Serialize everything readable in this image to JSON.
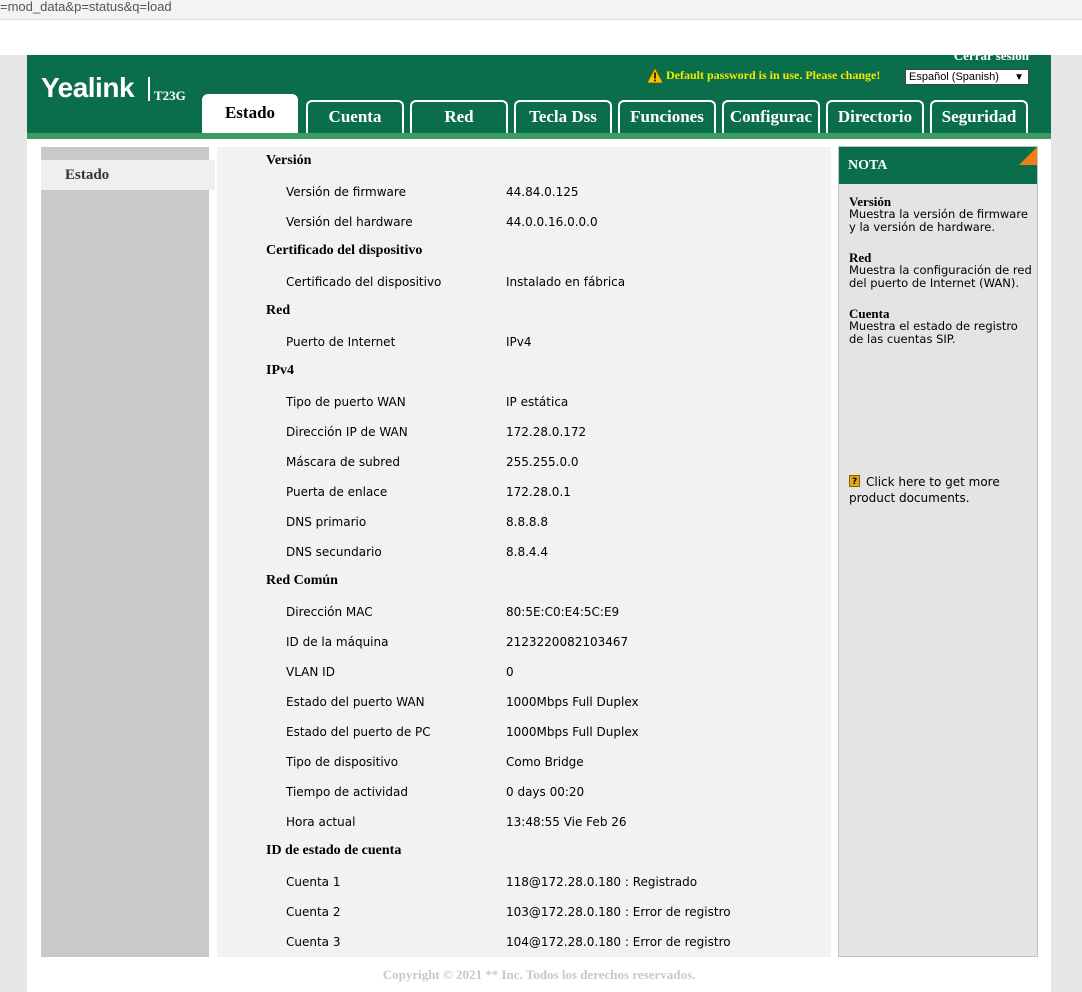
{
  "browser": {
    "url": "=mod_data&p=status&q=load"
  },
  "header": {
    "logo": "Yealink",
    "model": "T23G",
    "logout": "Cerrar sesión",
    "warning": "Default password is in use. Please change!",
    "language": "Español (Spanish)"
  },
  "tabs": [
    "Estado",
    "Cuenta",
    "Red",
    "Tecla Dss",
    "Funciones",
    "Configurac",
    "Directorio",
    "Seguridad"
  ],
  "sidebar": {
    "items": [
      "Estado"
    ]
  },
  "status": {
    "sections": [
      {
        "title": "Versión",
        "rows": [
          {
            "label": "Versión de firmware",
            "value": "44.84.0.125"
          },
          {
            "label": "Versión del hardware",
            "value": "44.0.0.16.0.0.0"
          }
        ]
      },
      {
        "title": "Certificado del dispositivo",
        "rows": [
          {
            "label": "Certificado del dispositivo",
            "value": "Instalado en fábrica"
          }
        ]
      },
      {
        "title": "Red",
        "rows": [
          {
            "label": "Puerto de Internet",
            "value": "IPv4"
          }
        ]
      },
      {
        "title": "IPv4",
        "rows": [
          {
            "label": "Tipo de puerto WAN",
            "value": "IP estática"
          },
          {
            "label": "Dirección IP de WAN",
            "value": "172.28.0.172"
          },
          {
            "label": "Máscara de subred",
            "value": "255.255.0.0"
          },
          {
            "label": "Puerta de enlace",
            "value": "172.28.0.1"
          },
          {
            "label": "DNS primario",
            "value": "8.8.8.8"
          },
          {
            "label": "DNS secundario",
            "value": "8.8.4.4"
          }
        ]
      },
      {
        "title": "Red Común",
        "rows": [
          {
            "label": "Dirección MAC",
            "value": "80:5E:C0:E4:5C:E9"
          },
          {
            "label": "ID de la máquina",
            "value": "2123220082103467"
          },
          {
            "label": "VLAN ID",
            "value": "0"
          },
          {
            "label": "Estado del puerto WAN",
            "value": "1000Mbps Full Duplex"
          },
          {
            "label": "Estado del puerto de PC",
            "value": "1000Mbps Full Duplex"
          },
          {
            "label": "Tipo de dispositivo",
            "value": "Como Bridge"
          },
          {
            "label": "Tiempo de actividad",
            "value": "0 days 00:20"
          },
          {
            "label": "Hora actual",
            "value": "13:48:55 Vie Feb 26"
          }
        ]
      },
      {
        "title": "ID de estado de cuenta",
        "rows": [
          {
            "label": "Cuenta 1",
            "value": "118@172.28.0.180 : Registrado"
          },
          {
            "label": "Cuenta 2",
            "value": "103@172.28.0.180 : Error de registro"
          },
          {
            "label": "Cuenta 3",
            "value": "104@172.28.0.180 : Error de registro"
          }
        ]
      }
    ]
  },
  "note": {
    "title": "NOTA",
    "items": [
      {
        "title": "Versión",
        "text": "Muestra la versión de firmware y la versión de hardware."
      },
      {
        "title": "Red",
        "text": "Muestra la configuración de red del puerto de Internet (WAN)."
      },
      {
        "title": "Cuenta",
        "text": "Muestra el estado de registro de las cuentas SIP."
      }
    ],
    "link": "Click here to get more product documents."
  },
  "footer": {
    "copyright": "Copyright © 2021 ** Inc. Todos los derechos reservados."
  },
  "colors": {
    "header": "#0b6e4a",
    "strip": "#3c9a63",
    "warning": "#f2ea00",
    "accent": "#f07f17"
  }
}
